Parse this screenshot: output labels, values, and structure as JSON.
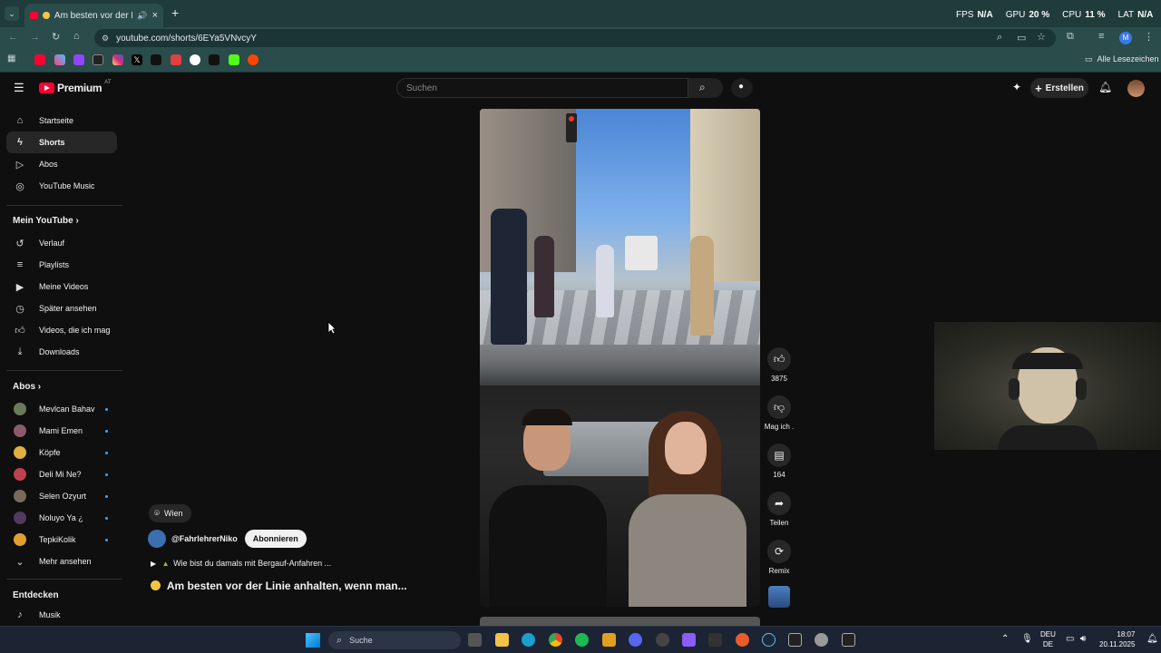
{
  "browser": {
    "tab_title": "Am besten vor der Lini",
    "url": "youtube.com/shorts/6EYa5VNvcyY",
    "bookmarks_label": "Alle Lesezeichen",
    "profile_initial": "M"
  },
  "overlay": {
    "fps_label": "FPS",
    "fps_value": "N/A",
    "gpu_label": "GPU",
    "gpu_value": "20 %",
    "cpu_label": "CPU",
    "cpu_value": "11 %",
    "lat_label": "LAT",
    "lat_value": "N/A"
  },
  "youtube": {
    "logo_text": "Premium",
    "logo_region": "AT",
    "search_placeholder": "Suchen",
    "create_label": "Erstellen"
  },
  "sidebar": {
    "main": [
      {
        "label": "Startseite",
        "icon": "home-icon"
      },
      {
        "label": "Shorts",
        "icon": "shorts-icon"
      },
      {
        "label": "Abos",
        "icon": "subscriptions-icon"
      },
      {
        "label": "YouTube Music",
        "icon": "music-icon"
      }
    ],
    "you_heading": "Mein YouTube",
    "you": [
      {
        "label": "Verlauf",
        "icon": "history-icon"
      },
      {
        "label": "Playlists",
        "icon": "playlists-icon"
      },
      {
        "label": "Meine Videos",
        "icon": "my-videos-icon"
      },
      {
        "label": "Später ansehen",
        "icon": "watch-later-icon"
      },
      {
        "label": "Videos, die ich mag",
        "icon": "liked-icon"
      },
      {
        "label": "Downloads",
        "icon": "download-icon"
      }
    ],
    "subs_heading": "Abos",
    "subs": [
      {
        "label": "Mevlcan Bahav",
        "color": "#6b7b5a"
      },
      {
        "label": "Mami Emen",
        "color": "#8a5a6a"
      },
      {
        "label": "Köpfe",
        "color": "#e0b040"
      },
      {
        "label": "Deli Mi Ne?",
        "color": "#c04050"
      },
      {
        "label": "Selen Ozyurt",
        "color": "#7a6a5a"
      },
      {
        "label": "Noluyo Ya ¿",
        "color": "#503a60"
      },
      {
        "label": "TepkiKolik",
        "color": "#e0a030"
      }
    ],
    "more_label": "Mehr ansehen",
    "explore_heading": "Entdecken",
    "explore": [
      {
        "label": "Musik",
        "icon": "music-note-icon"
      }
    ]
  },
  "short": {
    "location": "Wien",
    "channel": "@FahrlehrerNiko",
    "subscribe_label": "Abonnieren",
    "comment_preview": "Wie bist du damals mit Bergauf-Anfahren ...",
    "title": "Am besten vor der Linie anhalten, wenn man..."
  },
  "actions": {
    "like_count": "3875",
    "dislike_label": "Mag ich .",
    "comment_count": "164",
    "share_label": "Teilen",
    "remix_label": "Remix"
  },
  "taskbar": {
    "search_label": "Suche",
    "lang_top": "DEU",
    "lang_bottom": "DE",
    "time": "18:07",
    "date": "20.11.2025"
  }
}
